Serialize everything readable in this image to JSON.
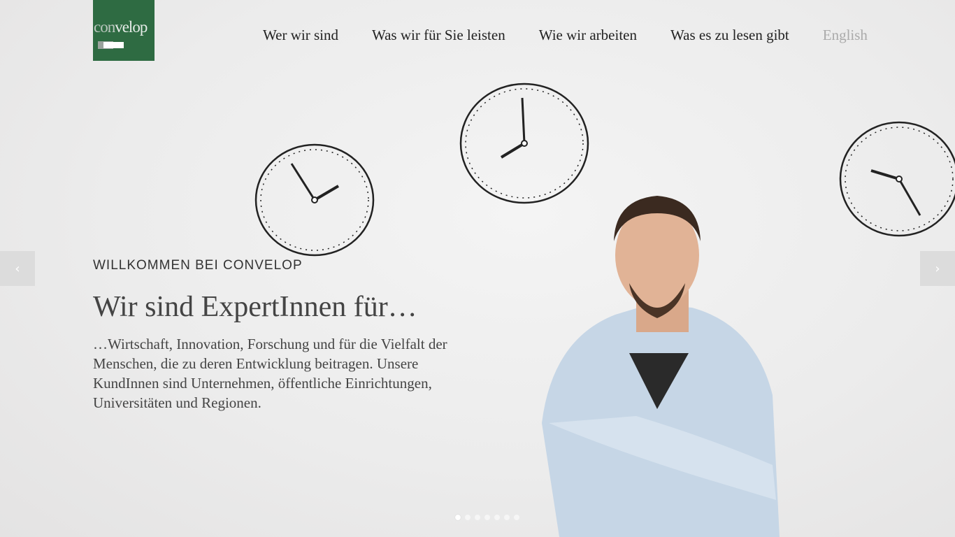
{
  "logo": {
    "text_a": "con",
    "text_b": "velop",
    "brand_color": "#2e6b42"
  },
  "nav": {
    "items": [
      "Wer wir sind",
      "Was wir für Sie leisten",
      "Wie wir arbeiten",
      "Was es zu lesen gibt"
    ],
    "language": "English"
  },
  "slider": {
    "prev_icon": "chevron-left-icon",
    "next_icon": "chevron-right-icon",
    "prev": "‹",
    "next": "›",
    "slide_count": 7,
    "active_slide": 1
  },
  "hero": {
    "kicker": "WILLKOMMEN BEI CONVELOP",
    "title": "Wir sind ExpertInnen für…",
    "text": "…Wirtschaft, Innovation, Forschung und für die Vielfalt der Menschen, die zu deren Entwicklung beitragen. Unsere KundInnen sind Unternehmen, öffentliche Einrichtungen, Universitäten und Regionen."
  }
}
